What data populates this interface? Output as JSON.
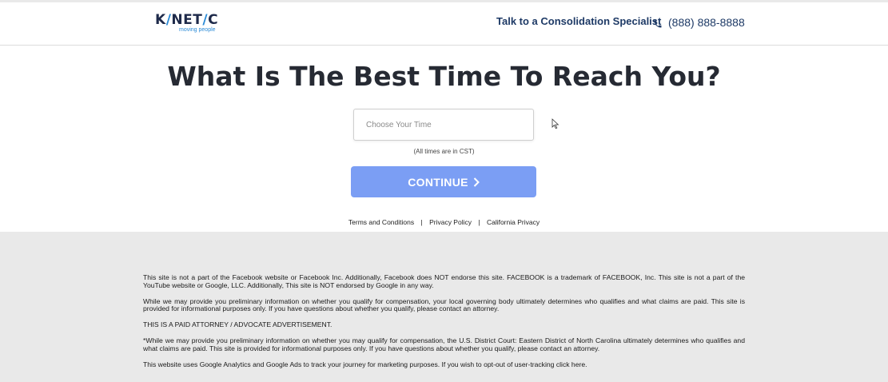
{
  "header": {
    "logo_text_left": "K",
    "logo_text_slash": "/",
    "logo_text_mid": "NET",
    "logo_text_slash2": "/",
    "logo_text_right": "C",
    "logo_tagline": "moving people",
    "specialist_label": "Talk to a Consolidation Specialist",
    "phone_number": "(888) 888-8888",
    "phone_icon": "phone-icon"
  },
  "main": {
    "headline": "What Is The Best Time To Reach You?",
    "time_input": {
      "placeholder": "Choose Your Time",
      "value": ""
    },
    "timezone_note": "(All times are in CST)",
    "continue_label": "CONTINUE",
    "continue_color": "#7b9ef4"
  },
  "links": [
    {
      "label": "Terms and Conditions"
    },
    {
      "label": "Privacy Policy"
    },
    {
      "label": "California Privacy"
    }
  ],
  "footer": {
    "background": "#e9e9e9",
    "disclaimers": [
      "This site is not a part of the Facebook website or Facebook Inc. Additionally, Facebook does NOT endorse this site. FACEBOOK is a trademark of FACEBOOK, Inc. This site is not a part of the YouTube website or Google, LLC. Additionally, This site is NOT endorsed by Google in any way.",
      "While we may provide you preliminary information on whether you qualify for compensation, your local governing body ultimately determines who qualifies and what claims are paid. This site is provided for informational purposes only. If you have questions about whether you qualify, please contact an attorney.",
      "THIS IS A PAID ATTORNEY / ADVOCATE ADVERTISEMENT.",
      "*While we may provide you preliminary information on whether you may qualify for compensation, the U.S. District Court: Eastern District of North Carolina ultimately determines who qualifies and what claims are paid. This site is provided for informational purposes only. If you have questions about whether you qualify, please contact an attorney.",
      "This website uses Google Analytics and Google Ads to track your journey for marketing purposes. If you wish to opt-out of user-tracking click here."
    ]
  }
}
